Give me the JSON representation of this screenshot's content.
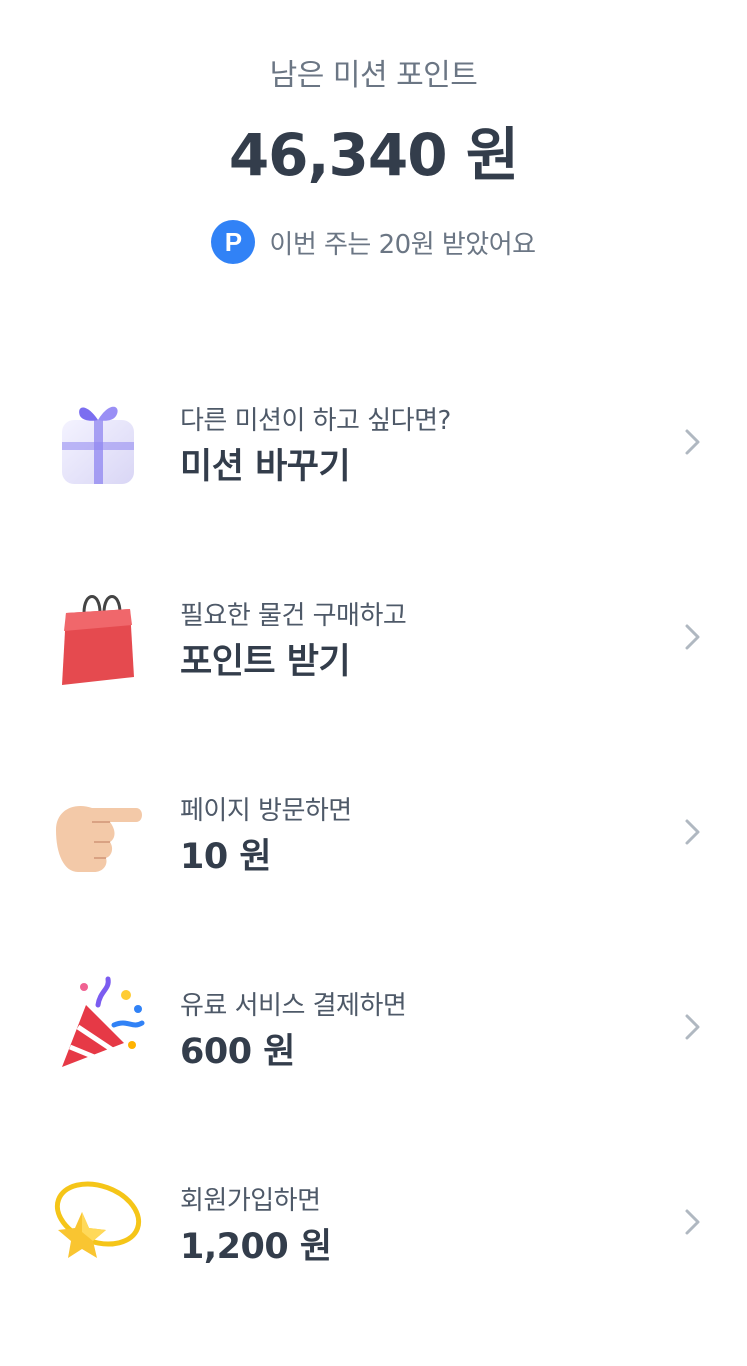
{
  "header": {
    "label": "남은 미션 포인트",
    "amount": "46,340 원"
  },
  "weekly": {
    "badge": "P",
    "text": "이번 주는 20원 받았어요"
  },
  "missions": [
    {
      "subtitle": "다른 미션이 하고 싶다면?",
      "title": "미션 바꾸기",
      "icon": "gift-box-icon"
    },
    {
      "subtitle": "필요한 물건 구매하고",
      "title": "포인트 받기",
      "icon": "shopping-bag-icon"
    },
    {
      "subtitle": "페이지 방문하면",
      "title": "10 원",
      "icon": "pointing-hand-icon"
    },
    {
      "subtitle": "유료 서비스 결제하면",
      "title": "600 원",
      "icon": "party-popper-icon"
    },
    {
      "subtitle": "회원가입하면",
      "title": "1,200 원",
      "icon": "star-icon"
    }
  ],
  "colors": {
    "accent": "#3182f6",
    "text_primary": "#333d4b",
    "text_secondary": "#6b7684",
    "chevron": "#b0b8c1"
  }
}
